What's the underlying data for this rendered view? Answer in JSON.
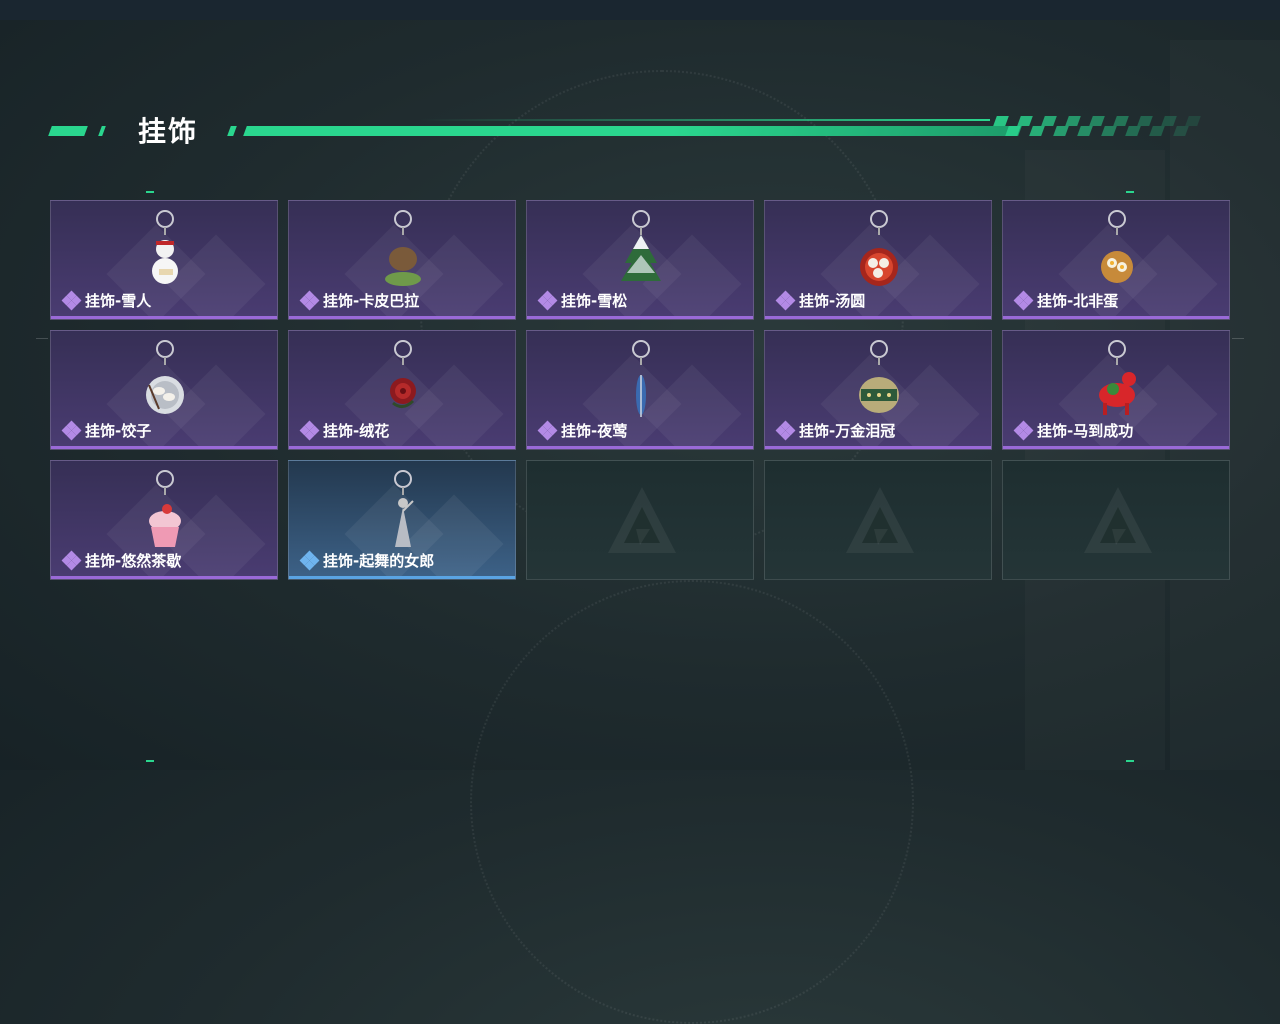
{
  "header": {
    "title": "挂饰"
  },
  "colors": {
    "accent": "#2ad68e",
    "purple_rarity": "#9a6ad8",
    "blue_rarity": "#5aa4e4"
  },
  "items": [
    {
      "name": "挂饰-雪人",
      "rarity": "purple",
      "icon": "snowman-charm-icon"
    },
    {
      "name": "挂饰-卡皮巴拉",
      "rarity": "purple",
      "icon": "capybara-charm-icon"
    },
    {
      "name": "挂饰-雪松",
      "rarity": "purple",
      "icon": "snow-pine-charm-icon"
    },
    {
      "name": "挂饰-汤圆",
      "rarity": "purple",
      "icon": "tangyuan-charm-icon"
    },
    {
      "name": "挂饰-北非蛋",
      "rarity": "purple",
      "icon": "shakshuka-charm-icon"
    },
    {
      "name": "挂饰-饺子",
      "rarity": "purple",
      "icon": "dumpling-charm-icon"
    },
    {
      "name": "挂饰-绒花",
      "rarity": "purple",
      "icon": "velvet-flower-charm-icon"
    },
    {
      "name": "挂饰-夜莺",
      "rarity": "purple",
      "icon": "nightingale-feather-charm-icon"
    },
    {
      "name": "挂饰-万金泪冠",
      "rarity": "purple",
      "icon": "crown-charm-icon"
    },
    {
      "name": "挂饰-马到成功",
      "rarity": "purple",
      "icon": "red-horse-charm-icon"
    },
    {
      "name": "挂饰-悠然茶歇",
      "rarity": "purple",
      "icon": "cupcake-charm-icon"
    },
    {
      "name": "挂饰-起舞的女郎",
      "rarity": "blue",
      "icon": "dancing-lady-charm-icon"
    }
  ],
  "empty_slots": 3,
  "empty_slot_icon": "game-logo-placeholder-icon"
}
